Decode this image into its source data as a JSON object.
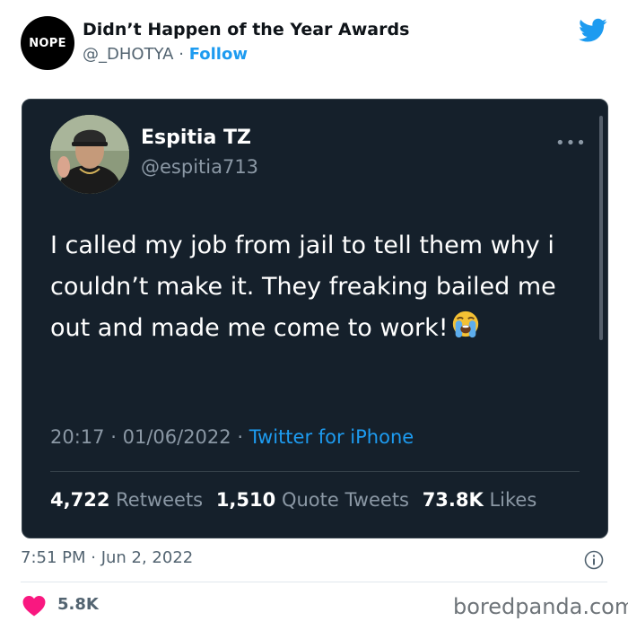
{
  "outer_tweet": {
    "avatar_text": "NOPE",
    "name": "Didn’t Happen of the Year Awards",
    "handle": "@_DHOTYA",
    "separator": "·",
    "follow_label": "Follow",
    "timestamp": "7:51 PM · Jun 2, 2022",
    "like_count": "5.8K",
    "twitter_icon": "twitter-bird-icon"
  },
  "embedded_tweet": {
    "name": "Espitia TZ",
    "handle": "@espitia713",
    "more_label": "•••",
    "text": "I called my job from jail to tell them why i couldn’t make it. They freaking bailed me out and made me come to work!",
    "emoji": "loudly-crying-face",
    "time": "20:17",
    "date": "01/06/2022",
    "separator": "·",
    "source": "Twitter for iPhone",
    "stats": {
      "retweets_count": "4,722",
      "retweets_label": "Retweets",
      "quotes_count": "1,510",
      "quotes_label": "Quote Tweets",
      "likes_count": "73.8K",
      "likes_label": "Likes"
    }
  },
  "watermark": "boredpanda.com",
  "colors": {
    "accent": "#1d9bf0",
    "dark_card": "#15202b",
    "heart": "#f91880"
  }
}
